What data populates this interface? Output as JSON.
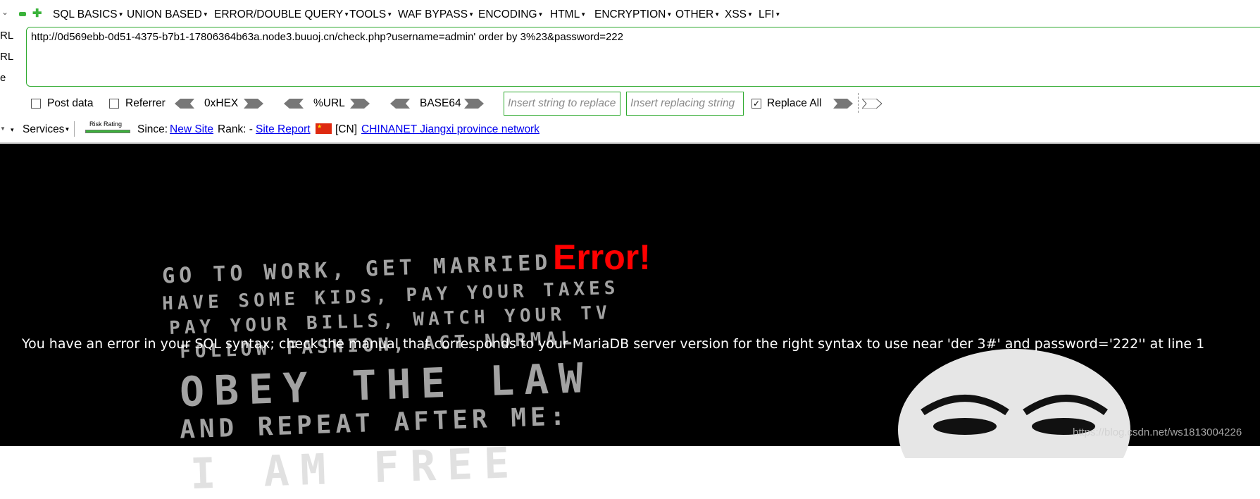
{
  "menubar": {
    "items": [
      {
        "label": "SQL BASICS"
      },
      {
        "label": "UNION BASED"
      },
      {
        "label": "ERROR/DOUBLE QUERY"
      },
      {
        "label": "TOOLS"
      },
      {
        "label": "WAF BYPASS"
      },
      {
        "label": "ENCODING"
      },
      {
        "label": "HTML"
      },
      {
        "label": "ENCRYPTION"
      },
      {
        "label": "OTHER"
      },
      {
        "label": "XSS"
      },
      {
        "label": "LFI"
      }
    ]
  },
  "side_labels": [
    "RL",
    "RL",
    "e"
  ],
  "url_bar": {
    "value": "http://0d569ebb-0d51-4375-b7b1-17806364b63a.node3.buuoj.cn/check.php?username=admin' order by 3%23&password=222"
  },
  "options": {
    "post_data": {
      "label": "Post data",
      "checked": false
    },
    "referrer": {
      "label": "Referrer",
      "checked": false
    },
    "hex_label": "0xHEX",
    "url_label": "%URL",
    "base64_label": "BASE64",
    "replace_input_placeholder": "Insert string to replace",
    "replacing_input_placeholder": "Insert replacing string",
    "replace_all": {
      "label": "Replace All",
      "checked": true
    }
  },
  "services_bar": {
    "services_label": "Services",
    "risk_rating_label": "Risk Rating",
    "since_label": "Since:",
    "new_site_link": "New Site",
    "rank_label": "Rank: -",
    "site_report_link": "Site Report",
    "country_code": "[CN]",
    "network_link": "CHINANET Jiangxi province network"
  },
  "page": {
    "error_title": "Error!",
    "error_message": "You have an error in your SQL syntax; check the manual that corresponds to your MariaDB server version for the right syntax to use near 'der 3#' and password='222'' at line 1",
    "poster_lines": [
      "GO TO WORK, GET MARRIED",
      "HAVE SOME KIDS, PAY YOUR TAXES",
      "PAY YOUR BILLS, WATCH YOUR TV",
      "FOLLOW FASHION, ACT NORMAL",
      "OBEY THE LAW",
      "AND REPEAT AFTER ME:",
      "I AM FREE"
    ],
    "watermark": "https://blog.csdn.net/ws1813004226"
  },
  "colors": {
    "accent_green": "#2eaa2e",
    "error_red": "#ff0000",
    "link_blue": "#0000ee"
  }
}
